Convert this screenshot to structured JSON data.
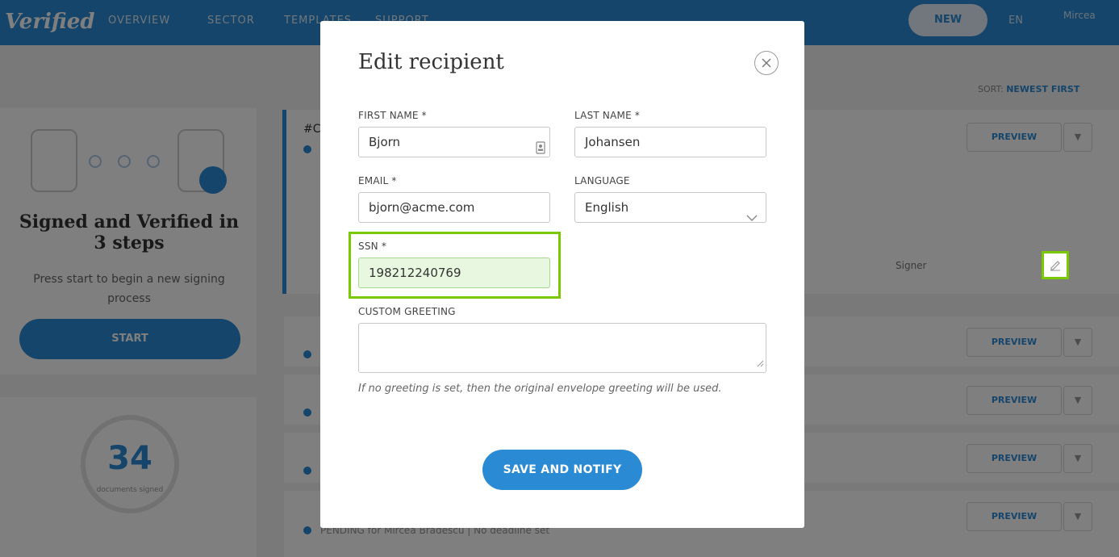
{
  "background": {
    "logo": "Verified",
    "nav": [
      "OVERVIEW",
      "SECTOR",
      "TEMPLATES",
      "SUPPORT"
    ],
    "new_button": "NEW",
    "language_pill": "EN",
    "user_label": "Mircea",
    "sort_label": "SORT:",
    "sort_value": "NEWEST FIRST",
    "side_title": "Signed and Verified in 3 steps",
    "side_subtitle": "Press start to begin a new signing process",
    "start_button": "START",
    "stat_number": "34",
    "stat_label": "documents signed",
    "preview_label": "PREVIEW",
    "bottom_status": "PENDING for Mircea Bradescu  |  No deadline set"
  },
  "modal": {
    "title": "Edit recipient",
    "first_name": {
      "label": "FIRST NAME *",
      "value": "Bjorn"
    },
    "last_name": {
      "label": "LAST NAME *",
      "value": "Johansen"
    },
    "email": {
      "label": "EMAIL *",
      "value": "bjorn@acme.com"
    },
    "language": {
      "label": "LANGUAGE",
      "value": "English"
    },
    "ssn": {
      "label": "SSN *",
      "value": "198212240769"
    },
    "custom_greeting": {
      "label": "CUSTOM GREETING",
      "value": ""
    },
    "hint": "If no greeting is set, then the original envelope greeting will be used.",
    "save_button": "SAVE AND NOTIFY"
  },
  "colors": {
    "brand": "#2a8ad4",
    "highlight": "#7ac800",
    "ssn_fill": "#e8f8e0"
  },
  "icons": {
    "close": "close-icon",
    "contact": "contact-card-icon",
    "dropdown": "chevron-down-icon",
    "edit": "pencil-icon"
  }
}
